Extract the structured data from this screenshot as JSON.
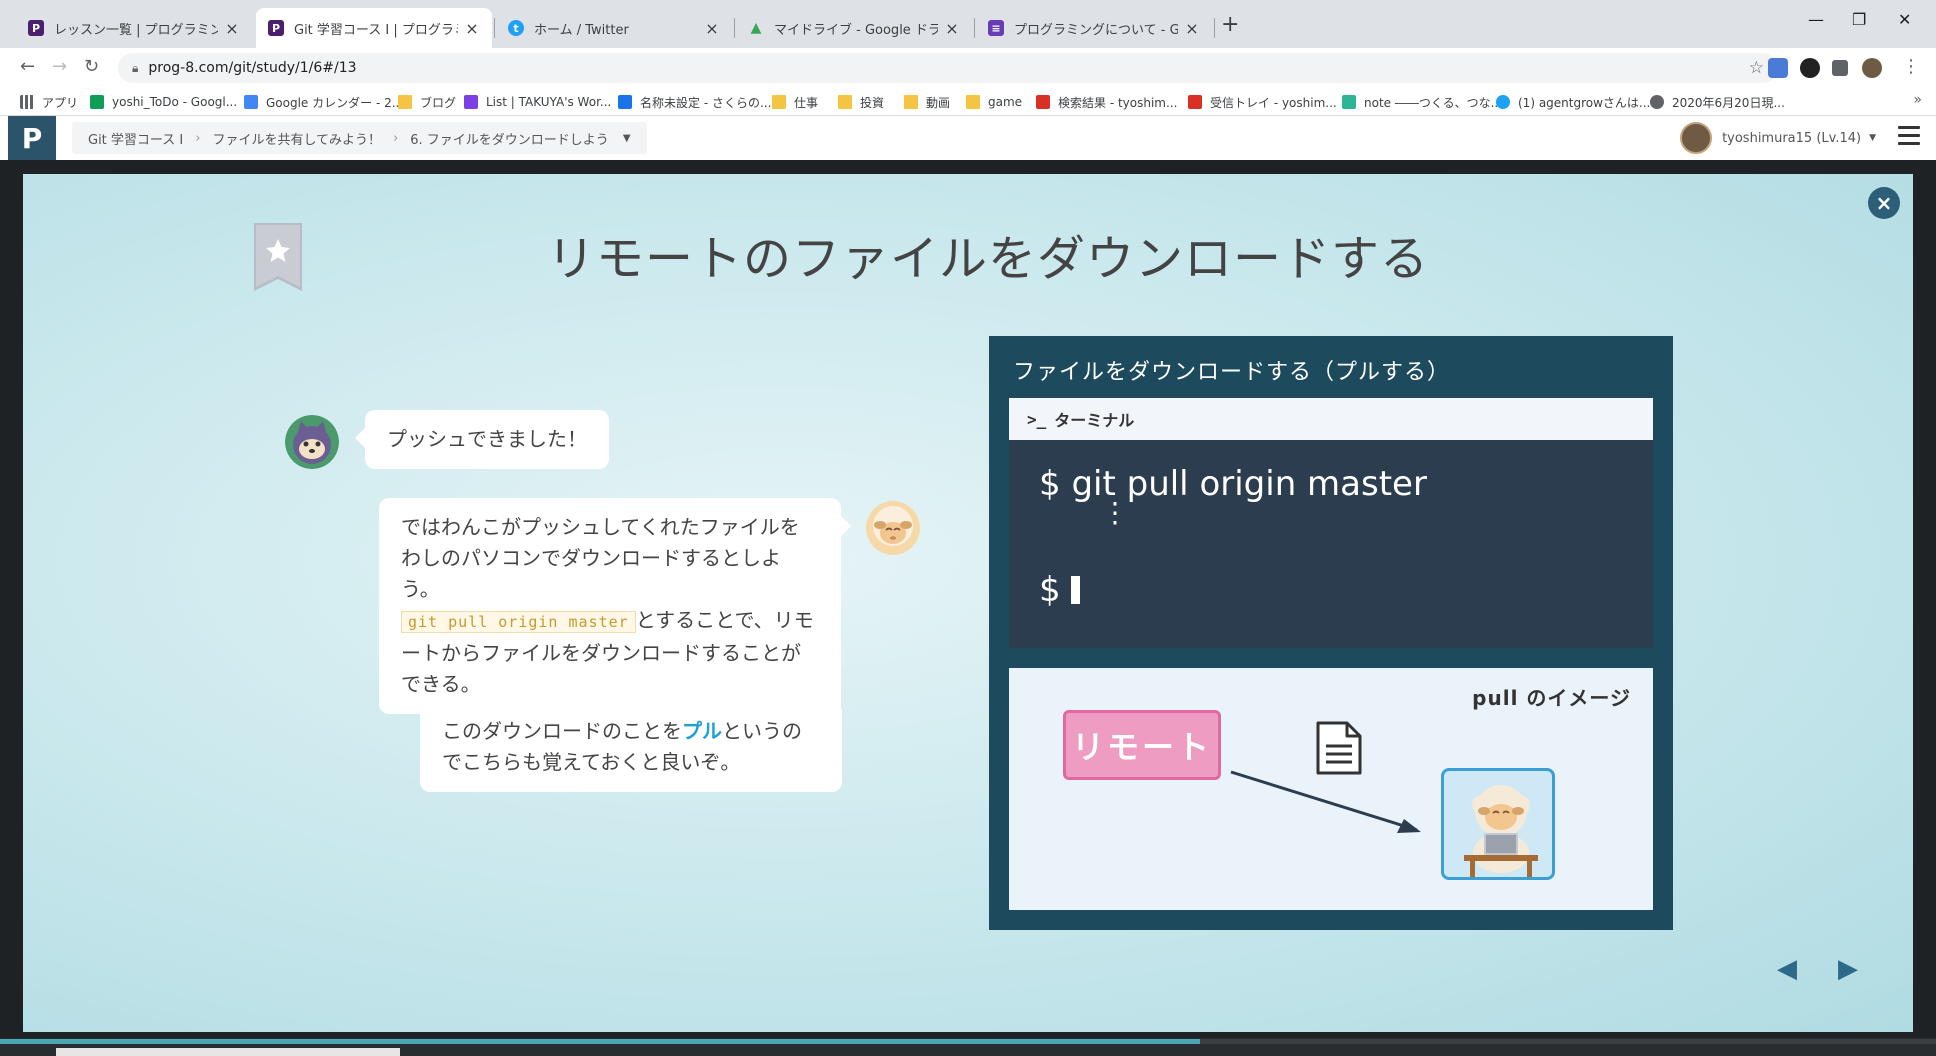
{
  "browser": {
    "tabs": [
      {
        "title": "レッスン一覧 | プログラミングの入門な",
        "icon_color": "#4b1f6d",
        "icon_text": "P",
        "active": false
      },
      {
        "title": "Git 学習コース I | プログラミングの入門",
        "icon_color": "#4b1f6d",
        "icon_text": "P",
        "active": true
      },
      {
        "title": "ホーム / Twitter",
        "icon_color": "#1da1f2",
        "icon_text": "t",
        "active": false
      },
      {
        "title": "マイドライブ - Google ドライブ",
        "icon_color": "#34a853",
        "icon_text": "▲",
        "active": false
      },
      {
        "title": "プログラミングについて - Google フォー",
        "icon_color": "#673ab7",
        "icon_text": "≡",
        "active": false
      }
    ],
    "url": "prog-8.com/git/study/1/6#/13",
    "bookmarks": [
      {
        "label": "アプリ",
        "icon": "apps-icon",
        "color": "#5f6368"
      },
      {
        "label": "yoshi_ToDo - Googl...",
        "icon": "sheets-icon",
        "color": "#0f9d58"
      },
      {
        "label": "Google カレンダー - 2...",
        "icon": "calendar-icon",
        "color": "#4285f4"
      },
      {
        "label": "ブログ",
        "icon": "folder-icon",
        "color": "#f4c542"
      },
      {
        "label": "List | TAKUYA's Wor...",
        "icon": "site-icon",
        "color": "#7b3fe4"
      },
      {
        "label": "名称未設定 - さくらの...",
        "icon": "site-icon",
        "color": "#1a73e8"
      },
      {
        "label": "仕事",
        "icon": "folder-icon",
        "color": "#f4c542"
      },
      {
        "label": "投資",
        "icon": "folder-icon",
        "color": "#f4c542"
      },
      {
        "label": "動画",
        "icon": "folder-icon",
        "color": "#f4c542"
      },
      {
        "label": "game",
        "icon": "folder-icon",
        "color": "#f4c542"
      },
      {
        "label": "検索結果 - tyoshim...",
        "icon": "gmail-icon",
        "color": "#d93025"
      },
      {
        "label": "受信トレイ - yoshim...",
        "icon": "gmail-icon",
        "color": "#d93025"
      },
      {
        "label": "note ――つくる、つな...",
        "icon": "note-icon",
        "color": "#2cb696"
      },
      {
        "label": "(1) agentgrowさんは...",
        "icon": "twitter-icon",
        "color": "#1da1f2"
      },
      {
        "label": "2020年6月20日現...",
        "icon": "globe-icon",
        "color": "#5f6368"
      }
    ]
  },
  "site": {
    "breadcrumb": [
      "Git 学習コース I",
      "ファイルを共有してみよう！",
      "6. ファイルをダウンロードしよう"
    ],
    "user": "tyoshimura15 (Lv.14)"
  },
  "slide": {
    "title": "リモートのファイルをダウンロードする",
    "msg1": "プッシュできました！",
    "msg2_a": "ではわんこがプッシュしてくれたファイルをわしのパソコンでダウンロードするとしよう。",
    "msg2_code": "git pull origin master",
    "msg2_b": "とすることで、リモートからファイルをダウンロードすることができる。",
    "msg3_a": "このダウンロードのことを",
    "msg3_hl": "プル",
    "msg3_b": "というのでこちらも覚えておくと良いぞ。",
    "diagram_title": "ファイルをダウンロードする（プルする）",
    "terminal_label": "ターミナル",
    "terminal_prompt_icon": ">_",
    "term_line1": "$ git pull origin master",
    "term_dots": "⋮",
    "term_line2": "$",
    "image_label": "pull のイメージ",
    "remote_label": "リモート"
  },
  "progress": 0.62
}
